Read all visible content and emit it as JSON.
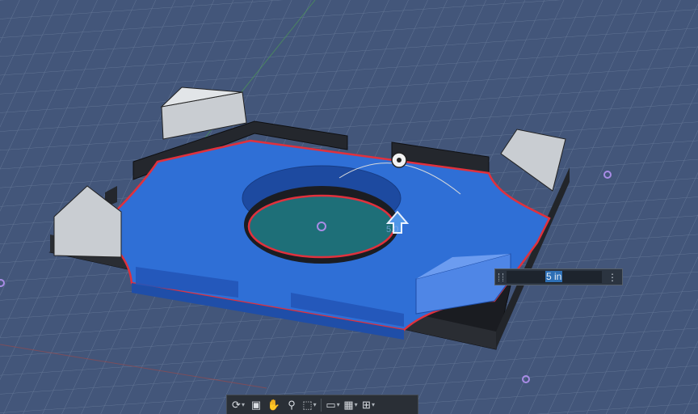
{
  "dimension_input": {
    "value": "5 in"
  },
  "manipulator": {
    "ghost_value": "5.0"
  },
  "navigation_bar": {
    "tools": [
      {
        "icon": "orbit-icon",
        "has_dropdown": true
      },
      {
        "icon": "look-at-icon",
        "has_dropdown": false
      },
      {
        "icon": "pan-icon",
        "has_dropdown": false
      },
      {
        "icon": "zoom-icon",
        "has_dropdown": false
      },
      {
        "icon": "fit-window-icon",
        "has_dropdown": true
      },
      {
        "icon": "display-settings-icon",
        "has_dropdown": true
      },
      {
        "icon": "grid-snaps-icon",
        "has_dropdown": true
      },
      {
        "icon": "viewports-icon",
        "has_dropdown": true
      }
    ]
  },
  "colors": {
    "background": "#3f5272",
    "grid": "#6f82a0",
    "selection_fill": "#2f6fd6",
    "profile_outline": "#e0313d",
    "body_black": "#1d2026",
    "corner_gray": "#c9cdd2"
  }
}
